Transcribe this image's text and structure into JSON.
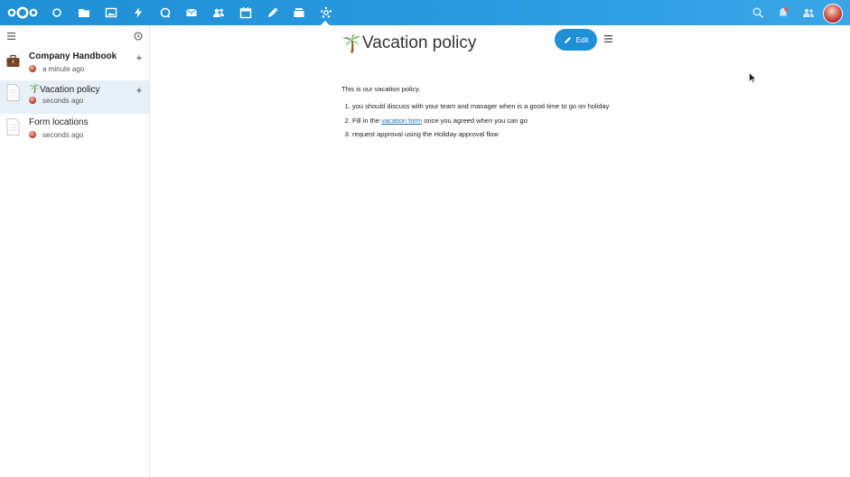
{
  "topbar": {
    "apps": [
      "dashboard-icon",
      "files-icon",
      "photos-icon",
      "activity-icon",
      "talk-icon",
      "mail-icon",
      "contacts-icon",
      "calendar-icon",
      "notes-icon",
      "deck-icon",
      "collectives-icon"
    ],
    "right": [
      "search-icon",
      "notifications-icon",
      "contacts-menu-icon",
      "user-avatar"
    ]
  },
  "sidebar": {
    "collections": [
      {
        "title": "Company Handbook",
        "time": "a minute ago"
      },
      {
        "title": "Vacation policy",
        "time": "seconds ago"
      },
      {
        "title": "Form locations",
        "time": "seconds ago"
      }
    ]
  },
  "page": {
    "title": "Vacation policy",
    "edit_label": "Edit",
    "intro": "This is our vacation policy.",
    "items": [
      {
        "text": "you should discuss with your team and manager when is a good time to go on holiday"
      },
      {
        "pre": "Fill in the ",
        "link": "vacation form",
        "post": " once you agreed when you can go"
      },
      {
        "text": "request approval using the Holiday approval flow"
      }
    ]
  },
  "colors": {
    "accent": "#1f8fd6",
    "header": "#2a9be0",
    "active_row": "#e8f0f7"
  }
}
